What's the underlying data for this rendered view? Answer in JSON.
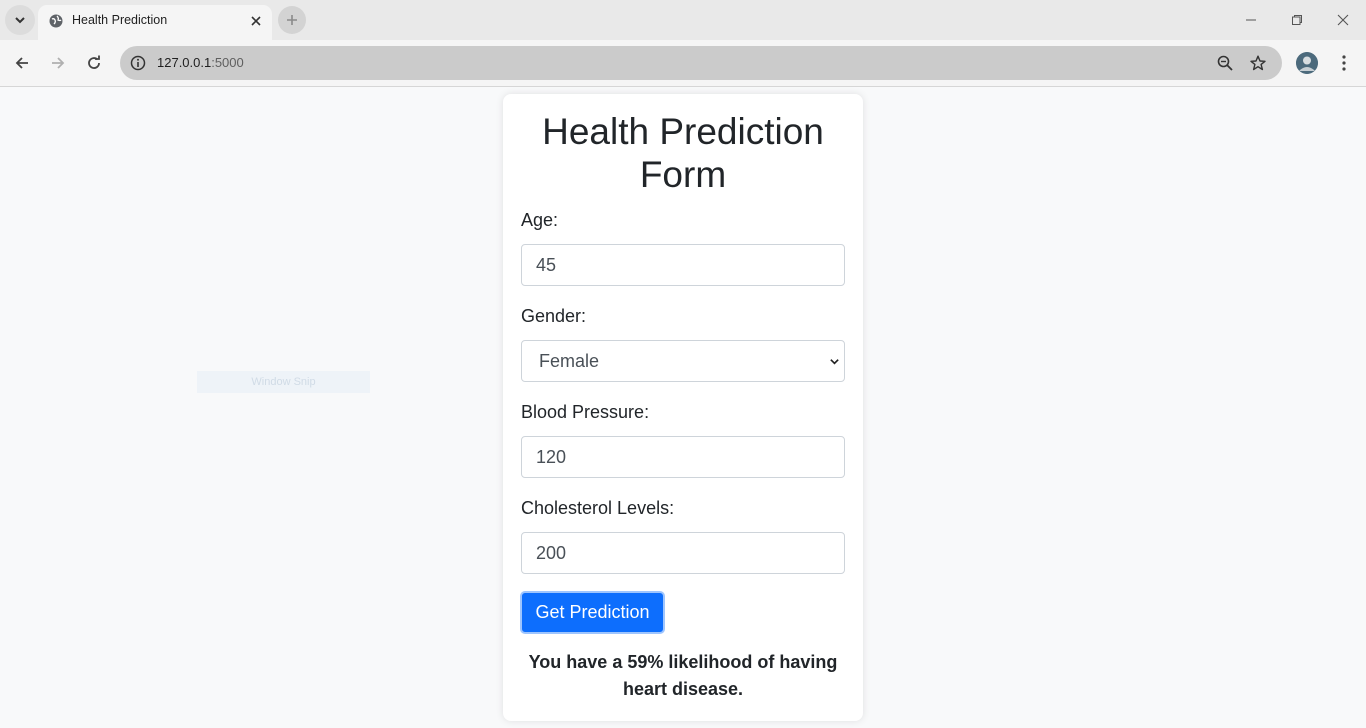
{
  "browser": {
    "tab_title": "Health Prediction",
    "url_host": "127.0.0.1",
    "url_port": ":5000"
  },
  "overlay": {
    "snip_label": "Window Snip"
  },
  "form": {
    "title": "Health Prediction Form",
    "age_label": "Age:",
    "age_value": "45",
    "gender_label": "Gender:",
    "gender_value": "Female",
    "bp_label": "Blood Pressure:",
    "bp_value": "120",
    "chol_label": "Cholesterol Levels:",
    "chol_value": "200",
    "submit_label": "Get Prediction"
  },
  "result": {
    "text": "You have a 59% likelihood of having heart disease."
  },
  "colors": {
    "primary_button": "#0d6efd",
    "page_background": "#f8f9fa"
  }
}
